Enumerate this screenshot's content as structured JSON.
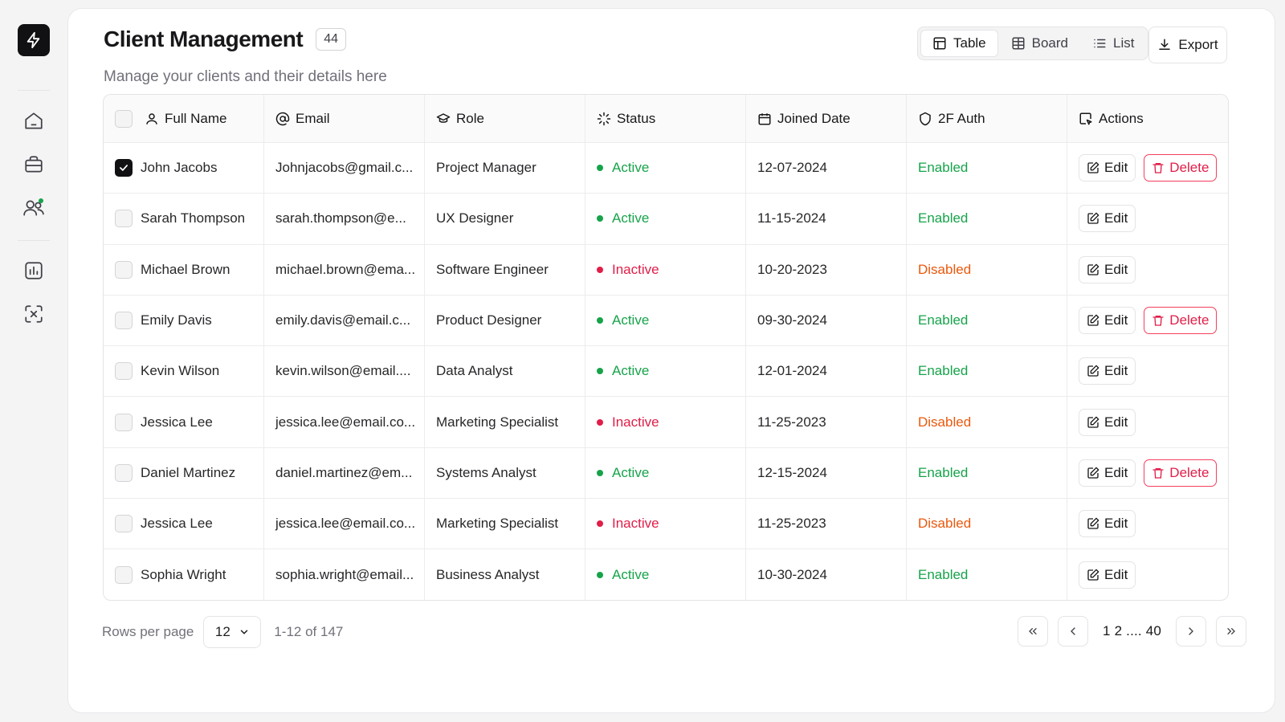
{
  "header": {
    "title": "Client Management",
    "count": "44",
    "subtitle": "Manage your clients and their details here"
  },
  "views": [
    "Table",
    "Board",
    "List"
  ],
  "active_view": "Table",
  "export_label": "Export",
  "columns": [
    "Full Name",
    "Email",
    "Role",
    "Status",
    "Joined Date",
    "2F Auth",
    "Actions"
  ],
  "rows": [
    {
      "name": "John Jacobs",
      "email": "Johnjacobs@gmail.c...",
      "role": "Project Manager",
      "status": "Active",
      "joined": "12-07-2024",
      "auth": "Enabled",
      "checked": true,
      "delete": true
    },
    {
      "name": "Sarah Thompson",
      "email": "sarah.thompson@e...",
      "role": "UX Designer",
      "status": "Active",
      "joined": "11-15-2024",
      "auth": "Enabled",
      "checked": false,
      "delete": false
    },
    {
      "name": "Michael Brown",
      "email": "michael.brown@ema...",
      "role": "Software Engineer",
      "status": "Inactive",
      "joined": "10-20-2023",
      "auth": "Disabled",
      "checked": false,
      "delete": false
    },
    {
      "name": "Emily Davis",
      "email": "emily.davis@email.c...",
      "role": "Product Designer",
      "status": "Active",
      "joined": "09-30-2024",
      "auth": "Enabled",
      "checked": false,
      "delete": true
    },
    {
      "name": "Kevin Wilson",
      "email": "kevin.wilson@email....",
      "role": "Data Analyst",
      "status": "Active",
      "joined": "12-01-2024",
      "auth": "Enabled",
      "checked": false,
      "delete": false
    },
    {
      "name": "Jessica Lee",
      "email": "jessica.lee@email.co...",
      "role": "Marketing Specialist",
      "status": "Inactive",
      "joined": "11-25-2023",
      "auth": "Disabled",
      "checked": false,
      "delete": false
    },
    {
      "name": "Daniel Martinez",
      "email": "daniel.martinez@em...",
      "role": "Systems Analyst",
      "status": "Active",
      "joined": "12-15-2024",
      "auth": "Enabled",
      "checked": false,
      "delete": true
    },
    {
      "name": "Jessica Lee",
      "email": "jessica.lee@email.co...",
      "role": "Marketing Specialist",
      "status": "Inactive",
      "joined": "11-25-2023",
      "auth": "Disabled",
      "checked": false,
      "delete": false
    },
    {
      "name": "Sophia Wright",
      "email": "sophia.wright@email...",
      "role": "Business Analyst",
      "status": "Active",
      "joined": "10-30-2024",
      "auth": "Enabled",
      "checked": false,
      "delete": false
    }
  ],
  "actions": {
    "edit": "Edit",
    "delete": "Delete"
  },
  "footer": {
    "rows_per_page_label": "Rows per page",
    "rows_per_page_value": "12",
    "range": "1-12 of 147",
    "pages": "1 2 .... 40"
  },
  "colors": {
    "active": "#16a34a",
    "inactive": "#e11d48",
    "disabled": "#ea580c",
    "accent": "#111113"
  }
}
